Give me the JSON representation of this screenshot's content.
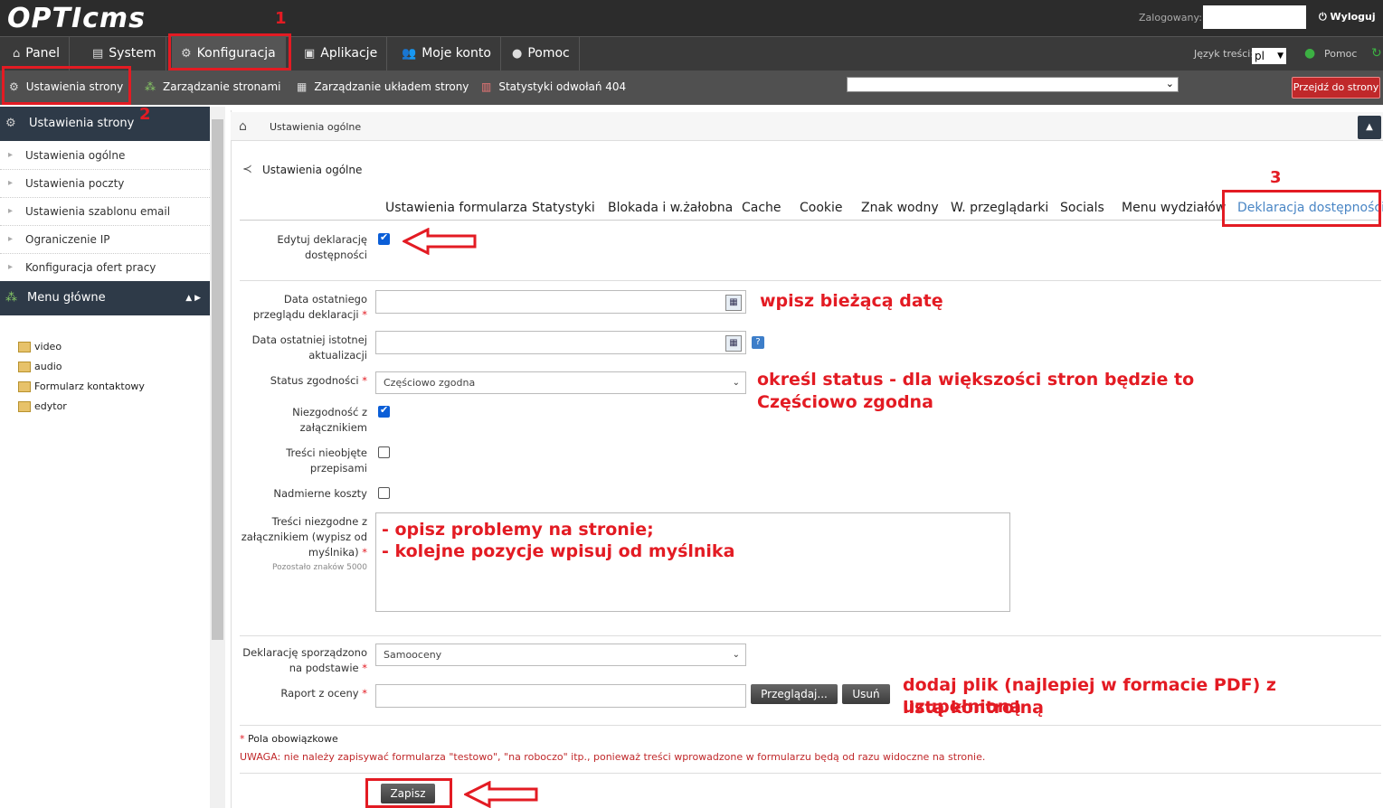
{
  "app": {
    "logo": "OPTIcms",
    "logged_label": "Zalogowany:",
    "logout_label": "Wyloguj"
  },
  "nav": {
    "items": [
      "Panel",
      "System",
      "Konfiguracja",
      "Aplikacje",
      "Moje konto",
      "Pomoc"
    ],
    "lang_label": "Język treści:",
    "lang_value": "pl",
    "help_label": "Pomoc"
  },
  "subnav": {
    "items": [
      "Ustawienia strony",
      "Zarządzanie stronami",
      "Zarządzanie układem strony",
      "Statystyki odwołań 404"
    ],
    "goto_label": "Przejdź do strony"
  },
  "sidebar": {
    "section1": "Ustawienia strony",
    "links": [
      "Ustawienia ogólne",
      "Ustawienia poczty",
      "Ustawienia szablonu email",
      "Ograniczenie IP",
      "Konfiguracja ofert pracy"
    ],
    "section2": "Menu główne",
    "tree": [
      "video",
      "audio",
      "Formularz kontaktowy",
      "edytor"
    ]
  },
  "breadcrumb": "Ustawienia ogólne",
  "section_title": "Ustawienia ogólne",
  "tabs": [
    "Ustawienia formularza",
    "Statystyki",
    "Blokada i w.żałobna",
    "Cache",
    "Cookie",
    "Znak wodny",
    "W. przeglądarki",
    "Socials",
    "Menu wydziałów",
    "Deklaracja dostępności"
  ],
  "form": {
    "edit_decl": {
      "label": "Edytuj deklarację dostępności",
      "checked": true
    },
    "review_date": {
      "label": "Data ostatniego przeglądu deklaracji",
      "value": ""
    },
    "update_date": {
      "label": "Data ostatniej istotnej aktualizacji",
      "value": ""
    },
    "status": {
      "label": "Status zgodności",
      "value": "Częściowo zgodna"
    },
    "attachments": {
      "label": "Niezgodność z załącznikiem",
      "checked": true
    },
    "not_covered": {
      "label": "Treści nieobjęte przepisami",
      "checked": false
    },
    "excessive": {
      "label": "Nadmierne koszty",
      "checked": false
    },
    "noncompliant": {
      "label": "Treści niezgodne z załącznikiem (wypisz od myślnika)",
      "hint": "Pozostało znaków 5000"
    },
    "basis": {
      "label": "Deklarację sporządzono na podstawie",
      "value": "Samooceny"
    },
    "report": {
      "label": "Raport z oceny",
      "browse": "Przeglądaj...",
      "remove": "Usuń"
    },
    "required_note": "Pola obowiązkowe",
    "required_star": "*",
    "warning": "UWAGA: nie należy zapisywać formularza \"testowo\", \"na roboczo\" itp., ponieważ treści wprowadzone w formularzu będą od razu widoczne na stronie.",
    "save": "Zapisz"
  },
  "annotations": {
    "n1": "1",
    "n2": "2",
    "n3": "3",
    "date_note": "wpisz bieżącą datę",
    "status_note_1": "określ status - dla większości stron będzie to",
    "status_note_2": "Częściowo zgodna",
    "problems_1": "- opisz problemy na stronie;",
    "problems_2": "- kolejne pozycje wpisuj od myślnika",
    "file_note_1": "dodaj plik (najlepiej w formacie PDF) z uzupełnioną",
    "file_note_2": "listą kontrolną"
  },
  "colors": {
    "accent_red": "#e31b23",
    "tab_active": "#4a86c5",
    "nav_dark": "#3a3a3a",
    "sidebar_head": "#2e3a48"
  }
}
